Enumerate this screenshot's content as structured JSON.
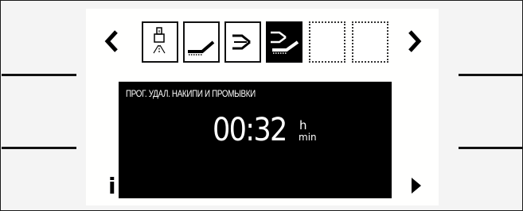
{
  "navigation": {
    "prev_label": "‹",
    "next_label": "›",
    "info_label": "i",
    "play_label": "▶"
  },
  "program_tiles": [
    {
      "icon": "nozzle-spray-icon",
      "state": "normal"
    },
    {
      "icon": "brush-cleaning-icon",
      "state": "normal"
    },
    {
      "icon": "pipe-cleaning-icon",
      "state": "normal"
    },
    {
      "icon": "descaling-rinse-icon",
      "state": "selected"
    },
    {
      "icon": "",
      "state": "empty"
    },
    {
      "icon": "",
      "state": "empty"
    }
  ],
  "screen": {
    "program_name": "ПРОГ. УДАЛ. НАКИПИ И ПРОМЫВКИ",
    "time_value": "00:32",
    "unit_hours": "h",
    "unit_minutes": "min"
  },
  "colors": {
    "display_background": "#000000",
    "display_text": "#ffffff",
    "panel_background": "#ffffff",
    "frame_background": "#f4f4f4"
  }
}
